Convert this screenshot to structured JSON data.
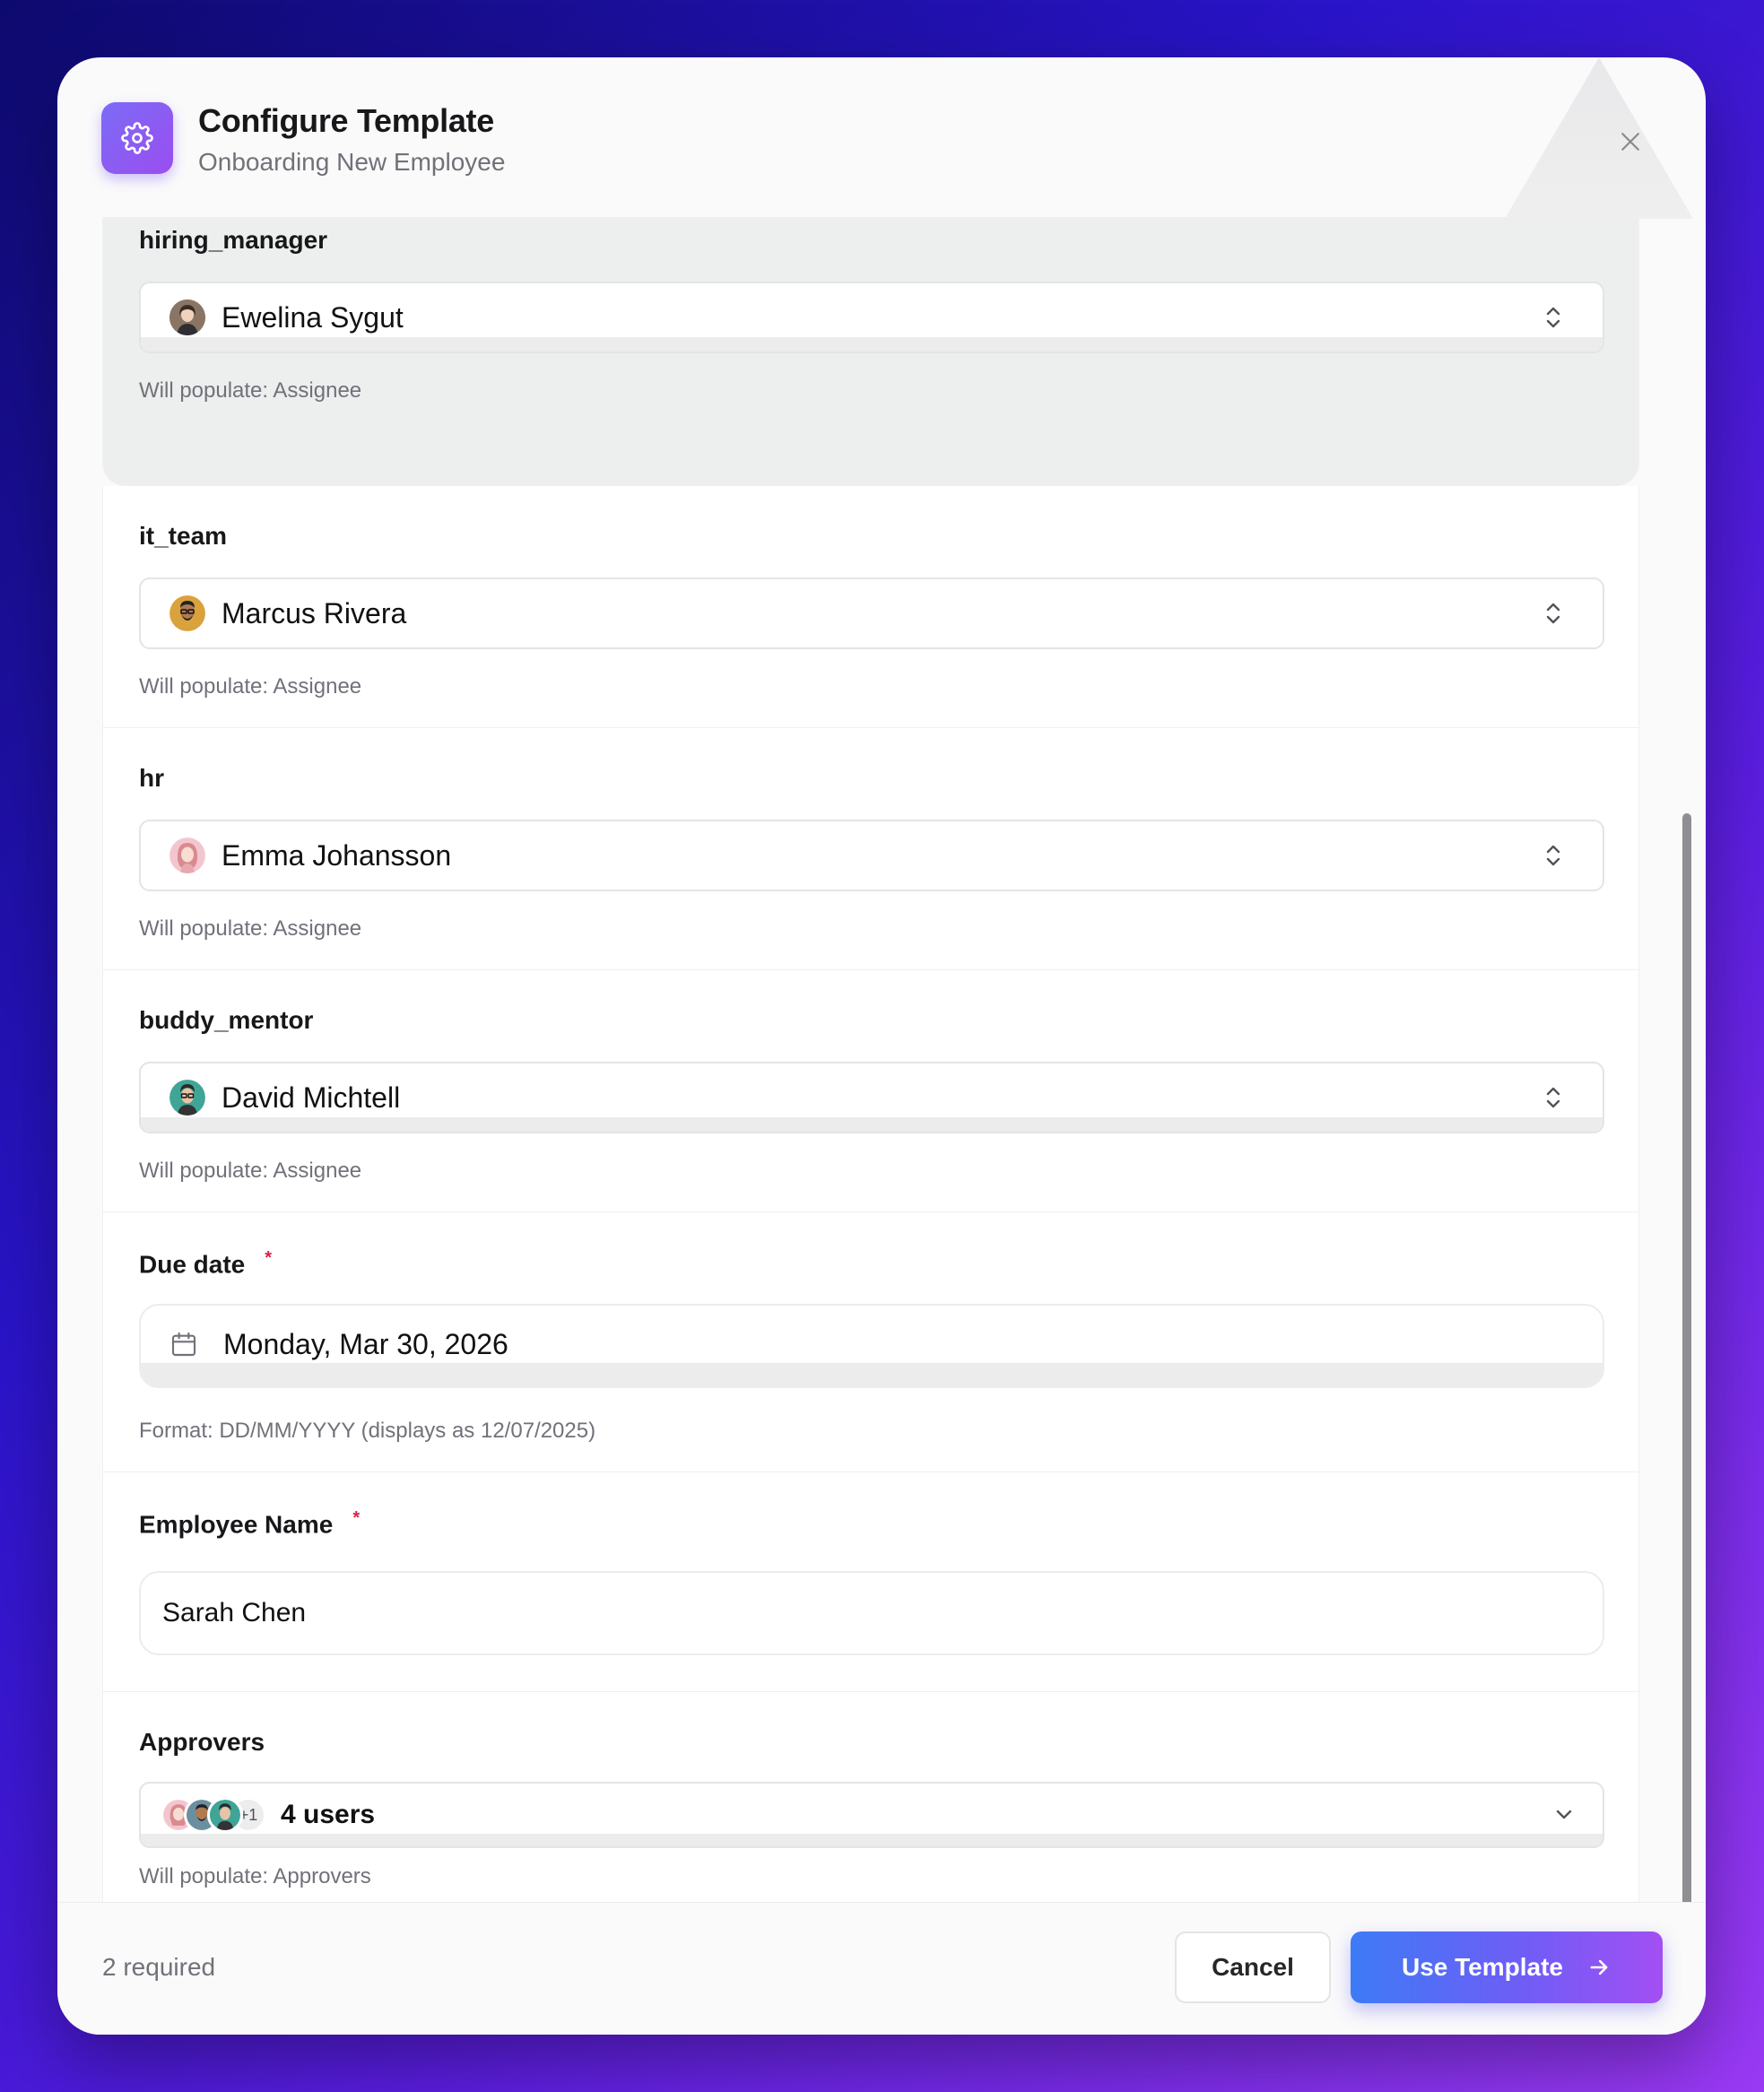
{
  "dialog": {
    "title": "Configure Template",
    "subtitle": "Onboarding New Employee",
    "header_icon": "gear-icon",
    "close_icon": "close-icon"
  },
  "fields": {
    "hiring_manager": {
      "label": "hiring_manager",
      "value": "Ewelina Sygut",
      "helper": "Will populate: Assignee"
    },
    "it_team": {
      "label": "it_team",
      "value": "Marcus Rivera",
      "helper": "Will populate: Assignee"
    },
    "hr": {
      "label": "hr",
      "value": "Emma Johansson",
      "helper": "Will populate: Assignee"
    },
    "buddy_mentor": {
      "label": "buddy_mentor",
      "value": "David Michtell",
      "helper": "Will populate: Assignee"
    },
    "due_date": {
      "label": "Due date",
      "required_mark": "*",
      "value": "Monday, Mar 30, 2026",
      "helper": "Format: DD/MM/YYYY (displays as 12/07/2025)",
      "icon": "calendar-icon"
    },
    "employee_name": {
      "label": "Employee Name",
      "required_mark": "*",
      "value": "Sarah Chen"
    },
    "approvers": {
      "label": "Approvers",
      "more_count": "+1",
      "value": "4 users",
      "helper": "Will populate: Approvers"
    }
  },
  "footer": {
    "required_text": "2 required",
    "cancel_label": "Cancel",
    "primary_label": "Use Template",
    "primary_icon": "arrow-right-icon"
  },
  "colors": {
    "accent_start": "#3d7bf5",
    "accent_end": "#a24ff3",
    "required": "#e11d48"
  }
}
